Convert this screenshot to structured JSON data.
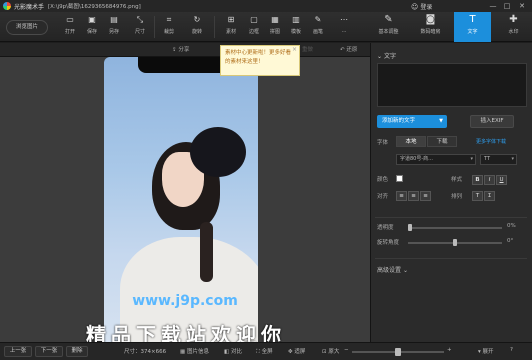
{
  "window": {
    "app_name": "光影魔术手",
    "file_path": "[X:\\j9p\\截图\\1629365684976.png]",
    "login_label": "登录",
    "minimize_glyph": "—",
    "maximize_glyph": "□",
    "close_glyph": "✕"
  },
  "toolbar": {
    "browse_label": "浏览图片",
    "tools": [
      {
        "label": "打开",
        "icon": "folder-icon",
        "glyph": "▭"
      },
      {
        "label": "保存",
        "icon": "save-icon",
        "glyph": "▣"
      },
      {
        "label": "另存",
        "icon": "save-as-icon",
        "glyph": "▤"
      },
      {
        "label": "尺寸",
        "icon": "resize-icon",
        "glyph": "⤡"
      },
      {
        "label": "裁剪",
        "icon": "crop-icon",
        "glyph": "⌗"
      },
      {
        "label": "旋转",
        "icon": "rotate-icon",
        "glyph": "↻"
      },
      {
        "label": "素材",
        "icon": "material-icon",
        "glyph": "⊞"
      },
      {
        "label": "边框",
        "icon": "frame-icon",
        "glyph": "▢"
      },
      {
        "label": "拼图",
        "icon": "collage-icon",
        "glyph": "▦"
      },
      {
        "label": "模板",
        "icon": "template-icon",
        "glyph": "▥"
      },
      {
        "label": "画笔",
        "icon": "brush-icon",
        "glyph": "✎"
      },
      {
        "label": "...",
        "icon": "more-icon",
        "glyph": "⋯"
      }
    ],
    "right_tabs": [
      {
        "label": "基本调整",
        "icon": "basic-adjust-icon",
        "glyph": "✎"
      },
      {
        "label": "数码暗房",
        "icon": "darkroom-icon",
        "glyph": "◙"
      },
      {
        "label": "文字",
        "icon": "text-icon",
        "glyph": "T"
      },
      {
        "label": "水印",
        "icon": "watermark-icon",
        "glyph": "✚"
      }
    ]
  },
  "subbar": {
    "share_label": "分享",
    "share_glyph": "⇪",
    "redo_label": "重做",
    "restore_label": "还原"
  },
  "tooltip": {
    "text": "素材中心更新啦！更多好看的素材来这里！",
    "close_glyph": "×"
  },
  "canvas": {
    "watermark_url": "www.j9p.com",
    "watermark_text": "精品下载站欢迎你"
  },
  "statusbar": {
    "prev_label": "上一张",
    "next_label": "下一张",
    "delete_label": "删除",
    "size_label": "尺寸：374×666",
    "info_label": "图片信息",
    "compare_label": "对比",
    "fullscreen_label": "全屏",
    "fit_label": "适屏",
    "original_label": "原大",
    "expand_label": "展开",
    "zoom_minus": "−",
    "zoom_plus": "+",
    "zoom_value": 0.5
  },
  "text_panel": {
    "section_title": "文字",
    "add_text_label": "添加新的文字",
    "add_dropdown": "▼",
    "exif_label": "插入EXIF",
    "font_label": "字体",
    "local_tab": "本地",
    "download_tab": "下载",
    "more_fonts_link": "更多字体下载",
    "font_name": "字道80号-商...",
    "font_size": "TT",
    "dropdown_glyph": "▾",
    "color_label": "颜色",
    "style_label": "样式",
    "bold_glyph": "B",
    "italic_glyph": "I",
    "underline_glyph": "U",
    "align_label": "对齐",
    "align_glyphs": [
      "≡",
      "≡",
      "≡"
    ],
    "arrange_label": "排列",
    "arrange_glyphs": [
      "T",
      "Ɪ"
    ],
    "opacity_label": "透明度",
    "opacity_value": "0%",
    "opacity_level": 0.0,
    "rotation_label": "旋转角度",
    "rotation_value": "0°",
    "rotation_level": 0.5,
    "advanced_label": "高级设置",
    "advanced_glyph": "⌄"
  }
}
